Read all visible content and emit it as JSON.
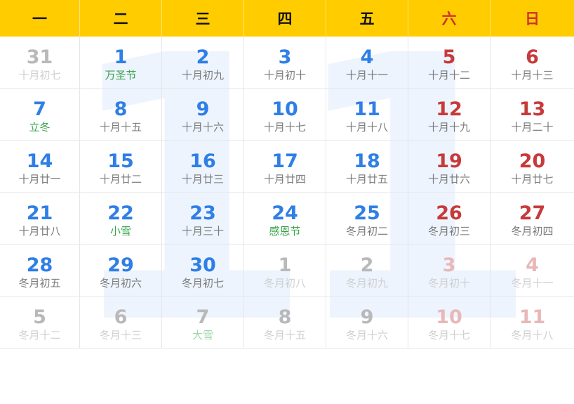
{
  "watermark": "11",
  "weekdays": [
    {
      "label": "一",
      "weekend": false
    },
    {
      "label": "二",
      "weekend": false
    },
    {
      "label": "三",
      "weekend": false
    },
    {
      "label": "四",
      "weekend": false
    },
    {
      "label": "五",
      "weekend": false
    },
    {
      "label": "六",
      "weekend": true
    },
    {
      "label": "日",
      "weekend": true
    }
  ],
  "days": [
    {
      "day": "31",
      "lunar": "十月初七",
      "num_style": "gray",
      "lunar_style": "light",
      "in_month": false
    },
    {
      "day": "1",
      "lunar": "万圣节",
      "num_style": "blue",
      "lunar_style": "green",
      "in_month": true
    },
    {
      "day": "2",
      "lunar": "十月初九",
      "num_style": "blue",
      "lunar_style": "gray",
      "in_month": true
    },
    {
      "day": "3",
      "lunar": "十月初十",
      "num_style": "blue",
      "lunar_style": "gray",
      "in_month": true
    },
    {
      "day": "4",
      "lunar": "十月十一",
      "num_style": "blue",
      "lunar_style": "gray",
      "in_month": true
    },
    {
      "day": "5",
      "lunar": "十月十二",
      "num_style": "red",
      "lunar_style": "gray",
      "in_month": true
    },
    {
      "day": "6",
      "lunar": "十月十三",
      "num_style": "red",
      "lunar_style": "gray",
      "in_month": true
    },
    {
      "day": "7",
      "lunar": "立冬",
      "num_style": "blue",
      "lunar_style": "green",
      "in_month": true
    },
    {
      "day": "8",
      "lunar": "十月十五",
      "num_style": "blue",
      "lunar_style": "gray",
      "in_month": true
    },
    {
      "day": "9",
      "lunar": "十月十六",
      "num_style": "blue",
      "lunar_style": "gray",
      "in_month": true
    },
    {
      "day": "10",
      "lunar": "十月十七",
      "num_style": "blue",
      "lunar_style": "gray",
      "in_month": true
    },
    {
      "day": "11",
      "lunar": "十月十八",
      "num_style": "blue",
      "lunar_style": "gray",
      "in_month": true
    },
    {
      "day": "12",
      "lunar": "十月十九",
      "num_style": "red",
      "lunar_style": "gray",
      "in_month": true
    },
    {
      "day": "13",
      "lunar": "十月二十",
      "num_style": "red",
      "lunar_style": "gray",
      "in_month": true
    },
    {
      "day": "14",
      "lunar": "十月廿一",
      "num_style": "blue",
      "lunar_style": "gray",
      "in_month": true
    },
    {
      "day": "15",
      "lunar": "十月廿二",
      "num_style": "blue",
      "lunar_style": "gray",
      "in_month": true
    },
    {
      "day": "16",
      "lunar": "十月廿三",
      "num_style": "blue",
      "lunar_style": "gray",
      "in_month": true
    },
    {
      "day": "17",
      "lunar": "十月廿四",
      "num_style": "blue",
      "lunar_style": "gray",
      "in_month": true
    },
    {
      "day": "18",
      "lunar": "十月廿五",
      "num_style": "blue",
      "lunar_style": "gray",
      "in_month": true
    },
    {
      "day": "19",
      "lunar": "十月廿六",
      "num_style": "red",
      "lunar_style": "gray",
      "in_month": true
    },
    {
      "day": "20",
      "lunar": "十月廿七",
      "num_style": "red",
      "lunar_style": "gray",
      "in_month": true
    },
    {
      "day": "21",
      "lunar": "十月廿八",
      "num_style": "blue",
      "lunar_style": "gray",
      "in_month": true
    },
    {
      "day": "22",
      "lunar": "小雪",
      "num_style": "blue",
      "lunar_style": "green",
      "in_month": true
    },
    {
      "day": "23",
      "lunar": "十月三十",
      "num_style": "blue",
      "lunar_style": "gray",
      "in_month": true
    },
    {
      "day": "24",
      "lunar": "感恩节",
      "num_style": "blue",
      "lunar_style": "green",
      "in_month": true
    },
    {
      "day": "25",
      "lunar": "冬月初二",
      "num_style": "blue",
      "lunar_style": "gray",
      "in_month": true
    },
    {
      "day": "26",
      "lunar": "冬月初三",
      "num_style": "red",
      "lunar_style": "gray",
      "in_month": true
    },
    {
      "day": "27",
      "lunar": "冬月初四",
      "num_style": "red",
      "lunar_style": "gray",
      "in_month": true
    },
    {
      "day": "28",
      "lunar": "冬月初五",
      "num_style": "blue",
      "lunar_style": "gray",
      "in_month": true
    },
    {
      "day": "29",
      "lunar": "冬月初六",
      "num_style": "blue",
      "lunar_style": "gray",
      "in_month": true
    },
    {
      "day": "30",
      "lunar": "冬月初七",
      "num_style": "blue",
      "lunar_style": "gray",
      "in_month": true
    },
    {
      "day": "1",
      "lunar": "冬月初八",
      "num_style": "gray",
      "lunar_style": "light",
      "in_month": false
    },
    {
      "day": "2",
      "lunar": "冬月初九",
      "num_style": "gray",
      "lunar_style": "light",
      "in_month": false
    },
    {
      "day": "3",
      "lunar": "冬月初十",
      "num_style": "lightred",
      "lunar_style": "light",
      "in_month": false
    },
    {
      "day": "4",
      "lunar": "冬月十一",
      "num_style": "lightred",
      "lunar_style": "light",
      "in_month": false
    },
    {
      "day": "5",
      "lunar": "冬月十二",
      "num_style": "gray",
      "lunar_style": "light",
      "in_month": false
    },
    {
      "day": "6",
      "lunar": "冬月十三",
      "num_style": "gray",
      "lunar_style": "light",
      "in_month": false
    },
    {
      "day": "7",
      "lunar": "大雪",
      "num_style": "gray",
      "lunar_style": "lightgreen",
      "in_month": false
    },
    {
      "day": "8",
      "lunar": "冬月十五",
      "num_style": "gray",
      "lunar_style": "light",
      "in_month": false
    },
    {
      "day": "9",
      "lunar": "冬月十六",
      "num_style": "gray",
      "lunar_style": "light",
      "in_month": false
    },
    {
      "day": "10",
      "lunar": "冬月十七",
      "num_style": "lightred",
      "lunar_style": "light",
      "in_month": false
    },
    {
      "day": "11",
      "lunar": "冬月十八",
      "num_style": "lightred",
      "lunar_style": "light",
      "in_month": false
    }
  ]
}
